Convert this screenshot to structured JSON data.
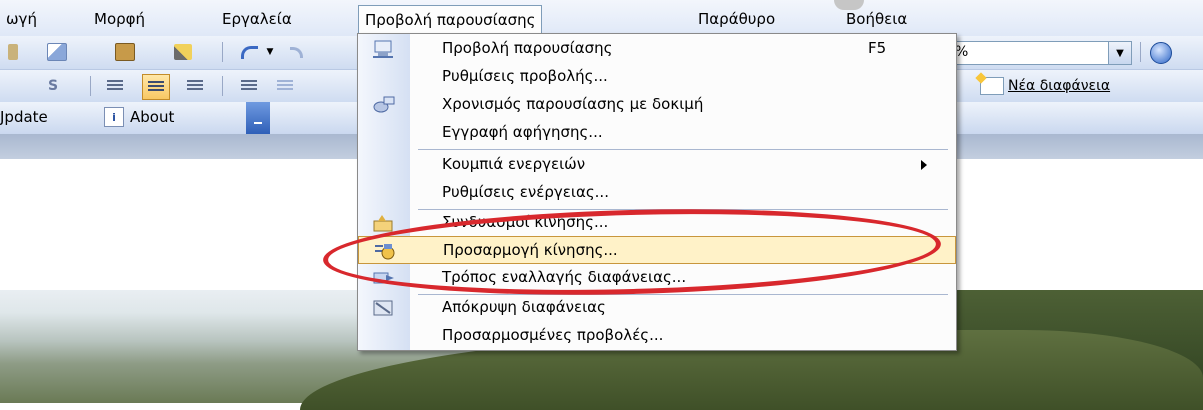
{
  "menubar": {
    "items": [
      {
        "label": "ωγή"
      },
      {
        "label": "Μορφή"
      },
      {
        "label": "Εργαλεία"
      },
      {
        "label": "Προβολή παρουσίασης"
      },
      {
        "label": "Παράθυρο"
      },
      {
        "label": "Βοήθεια"
      }
    ]
  },
  "toolbar": {
    "zoom_value": "%",
    "new_slide_label": "Νέα διαφάνεια",
    "update_label": "Jpdate",
    "about_label": "About",
    "about_icon_letter": "i"
  },
  "dropdown": {
    "items": [
      {
        "label": "Προβολή παρουσίασης",
        "shortcut": "F5",
        "icon": "projector-icon"
      },
      {
        "label": "Ρυθμίσεις προβολής..."
      },
      {
        "label": "Χρονισμός παρουσίασης με δοκιμή",
        "icon": "timer-icon"
      },
      {
        "label": "Εγγραφή αφήγησης..."
      },
      {
        "label": "Κουμπιά ενεργειών",
        "submenu": true
      },
      {
        "label": "Ρυθμίσεις ενέργειας..."
      },
      {
        "label": "Συνδυασμοί κίνησης...",
        "icon": "animation-schemes-icon"
      },
      {
        "label": "Προσαρμογή κίνησης...",
        "icon": "custom-animation-icon",
        "highlighted": true
      },
      {
        "label": "Τρόπος εναλλαγής διαφάνειας...",
        "icon": "transition-icon"
      },
      {
        "label": "Απόκρυψη διαφάνειας",
        "icon": "hide-slide-icon"
      },
      {
        "label": "Προσαρμοσμένες προβολές..."
      }
    ]
  },
  "colors": {
    "highlight_ring": "#d8282d",
    "menu_highlight": "#fff2c8"
  }
}
